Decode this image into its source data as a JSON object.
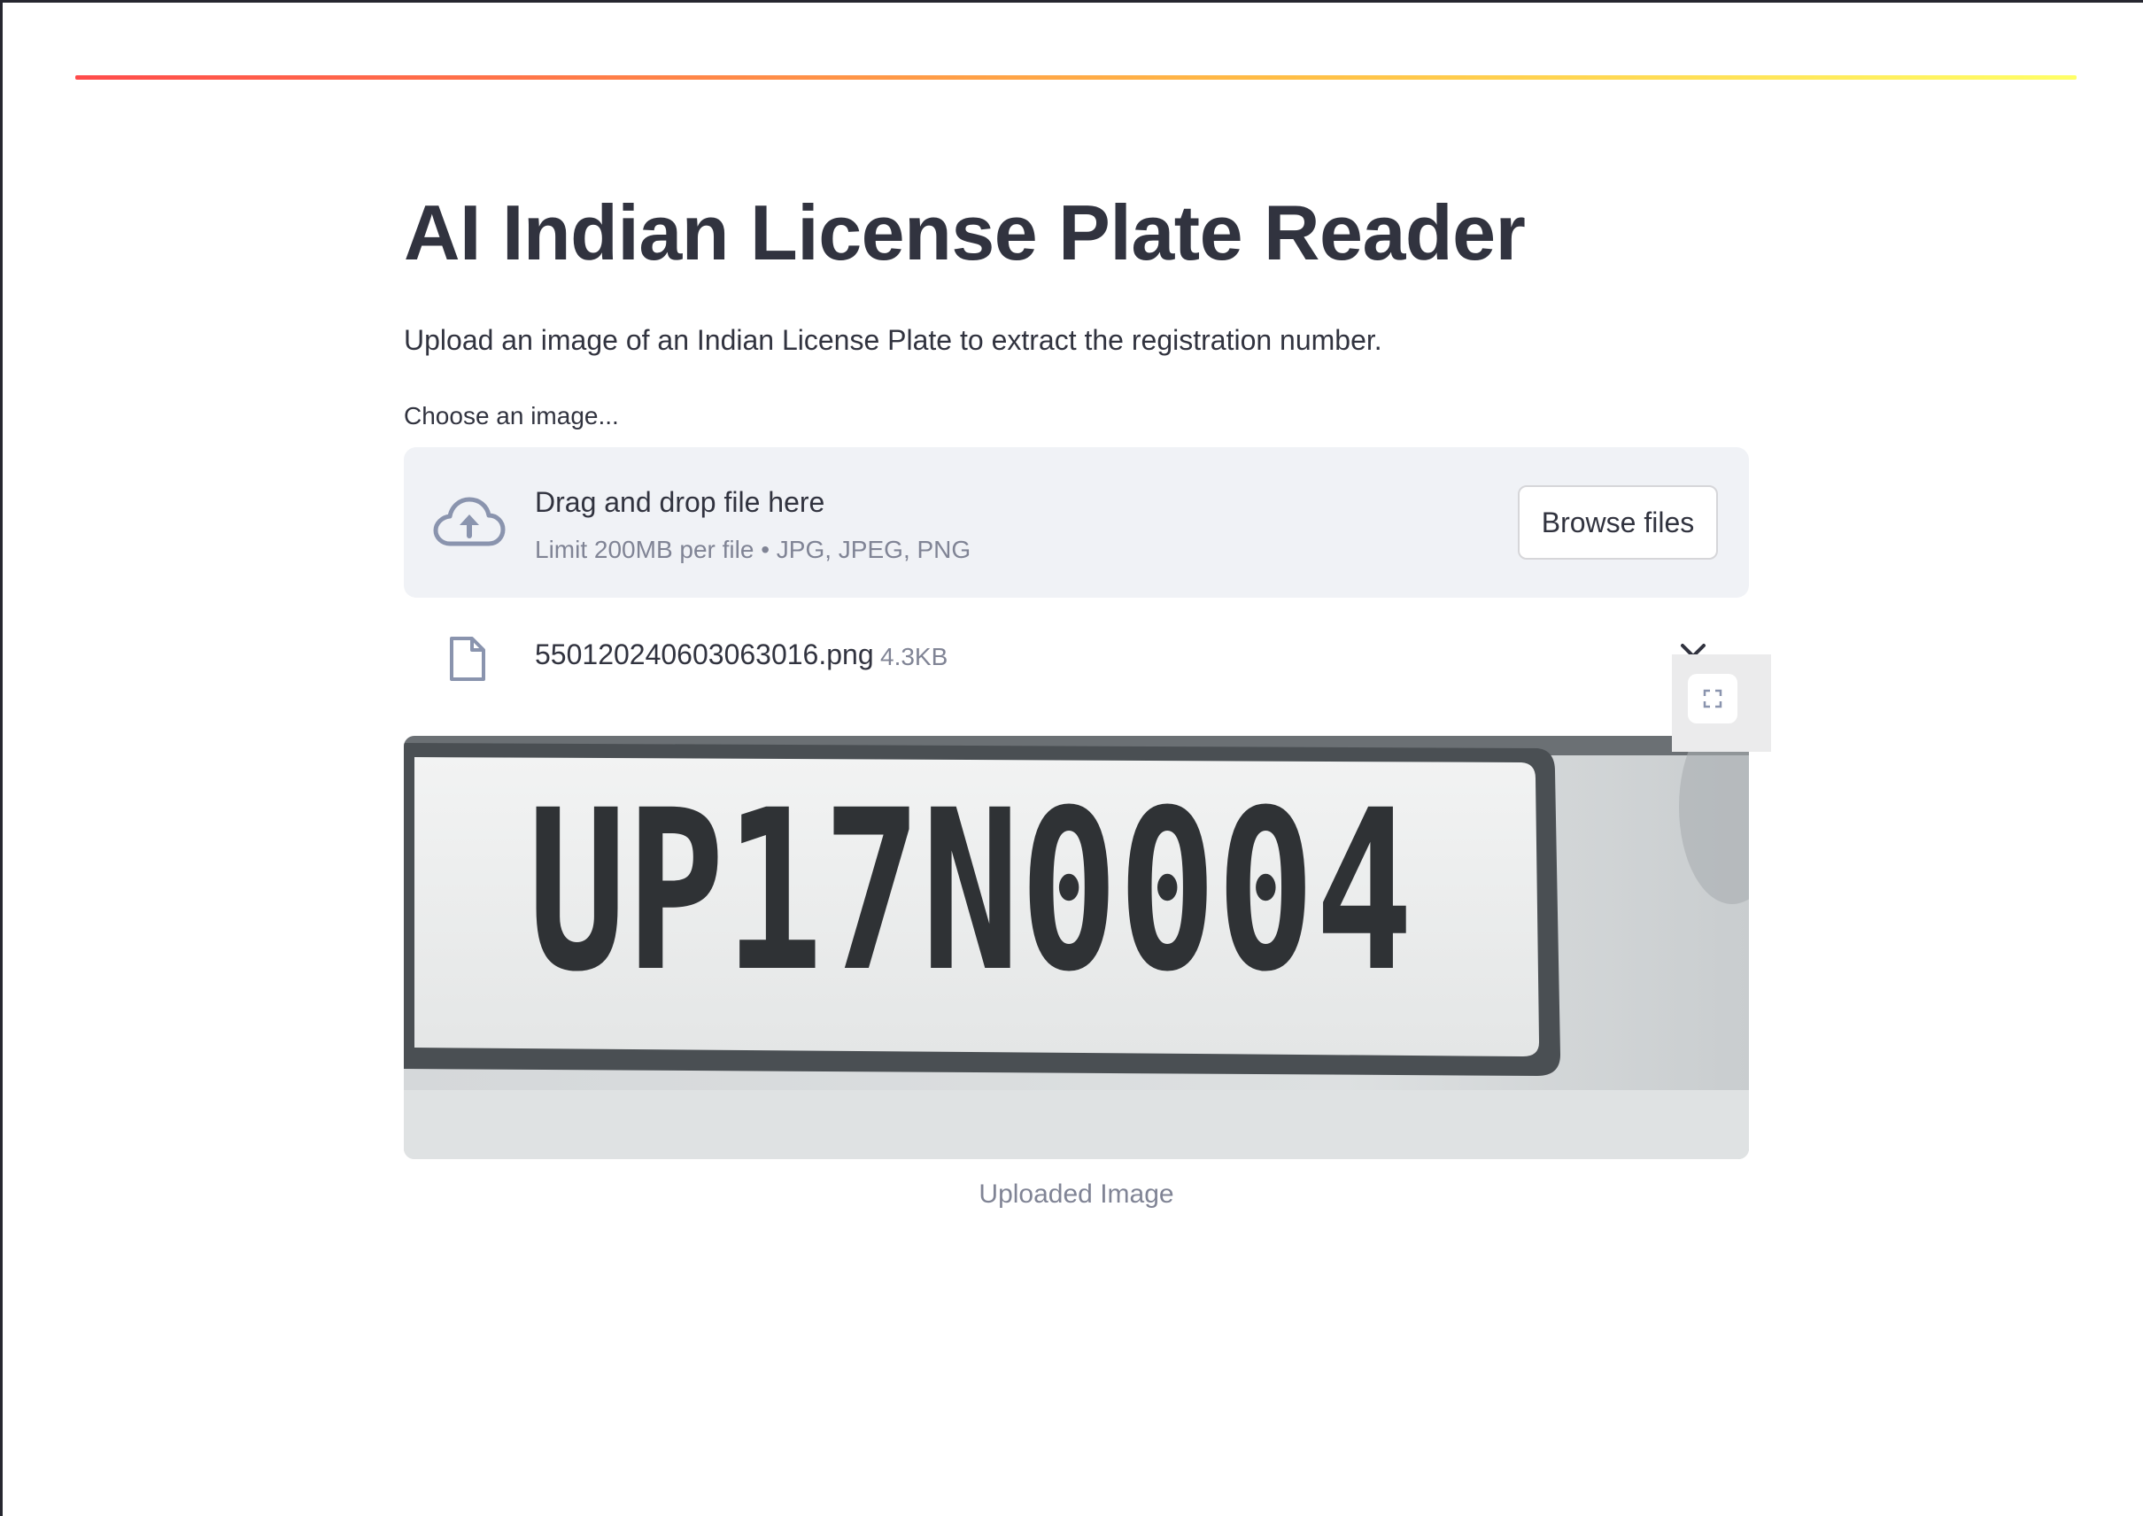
{
  "app": {
    "title": "AI Indian License Plate Reader",
    "subtitle": "Upload an image of an Indian License Plate to extract the registration number."
  },
  "uploader": {
    "label": "Choose an image...",
    "drag_text": "Drag and drop file here",
    "limit_text": "Limit 200MB per file • JPG, JPEG, PNG",
    "browse_label": "Browse files",
    "icon": "cloud-upload-icon"
  },
  "uploaded_file": {
    "name": "550120240603063016.png",
    "size": "4.3KB",
    "icon": "file-icon",
    "remove_icon": "close-icon"
  },
  "image": {
    "plate_text": "UP17N0004",
    "caption": "Uploaded Image",
    "fullscreen_icon": "fullscreen-icon"
  },
  "colors": {
    "text": "#31333f",
    "muted": "#808495",
    "dropzone_bg": "#f0f2f6",
    "icon": "#8a94ae",
    "accent_start": "#ff4b4b",
    "accent_end": "#ffff66"
  }
}
